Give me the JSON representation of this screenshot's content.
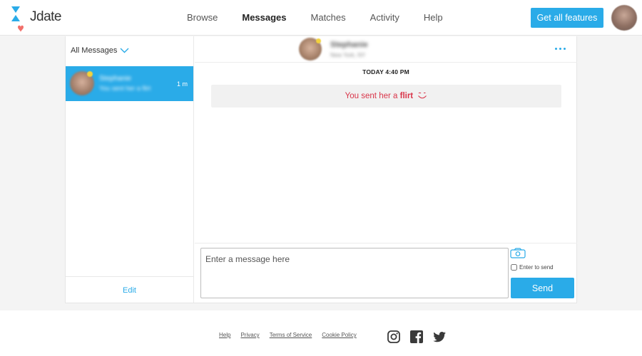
{
  "brand": {
    "logo_text": "Jdate"
  },
  "nav": {
    "items": [
      "Browse",
      "Messages",
      "Matches",
      "Activity",
      "Help"
    ],
    "active": "Messages"
  },
  "header": {
    "cta_label": "Get all features"
  },
  "sidebar": {
    "filter_label": "All Messages",
    "conversation": {
      "name": "Stephanie",
      "preview": "You sent her a flirt",
      "time": "1 m"
    },
    "edit_label": "Edit"
  },
  "chat": {
    "contact_name": "Stephanie",
    "contact_sub": "New York, NY",
    "timestamp": "TODAY 4:40 PM",
    "flirt_prefix": "You sent her a",
    "flirt_word": "flirt",
    "input_placeholder": "Enter a message here",
    "enter_to_send_label": "Enter to send",
    "send_label": "Send"
  },
  "footer": {
    "links": [
      "Help",
      "Privacy",
      "Terms of Service",
      "Cookie Policy"
    ],
    "social": [
      "instagram-icon",
      "facebook-icon",
      "twitter-icon"
    ]
  },
  "colors": {
    "accent": "#2aabe8",
    "flirt_text": "#d9354a",
    "background": "#f4f4f4"
  }
}
